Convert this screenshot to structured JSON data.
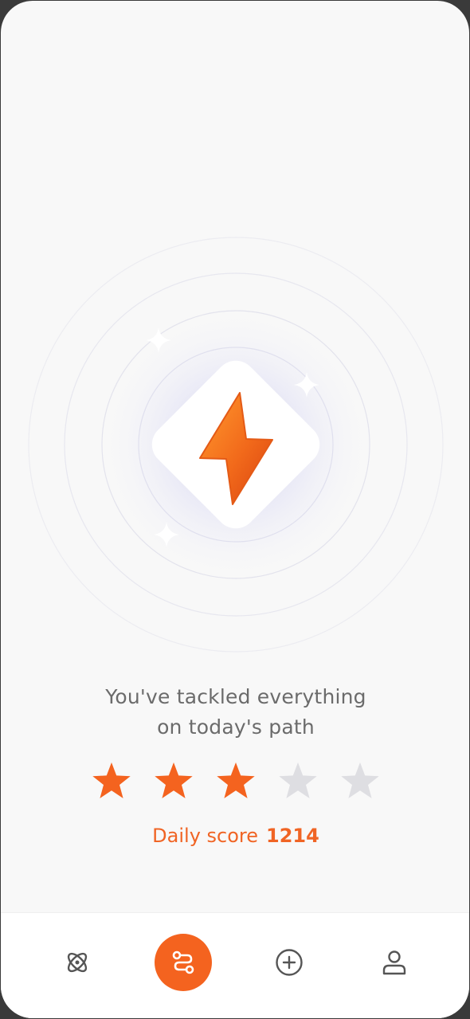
{
  "message": {
    "line1": "You've tackled everything",
    "line2": "on today's path"
  },
  "rating": {
    "filled": 3,
    "total": 5,
    "filled_color": "#f4631f",
    "empty_color": "#dedee2"
  },
  "score": {
    "label": "Daily score",
    "value": "1214"
  },
  "navbar": {
    "items": [
      {
        "icon": "orbit-icon",
        "active": false
      },
      {
        "icon": "path-icon",
        "active": true
      },
      {
        "icon": "plus-circle-icon",
        "active": false
      },
      {
        "icon": "profile-icon",
        "active": false
      }
    ]
  },
  "colors": {
    "accent": "#f4631f",
    "text": "#6b6b6b",
    "background": "#f8f8f8"
  }
}
